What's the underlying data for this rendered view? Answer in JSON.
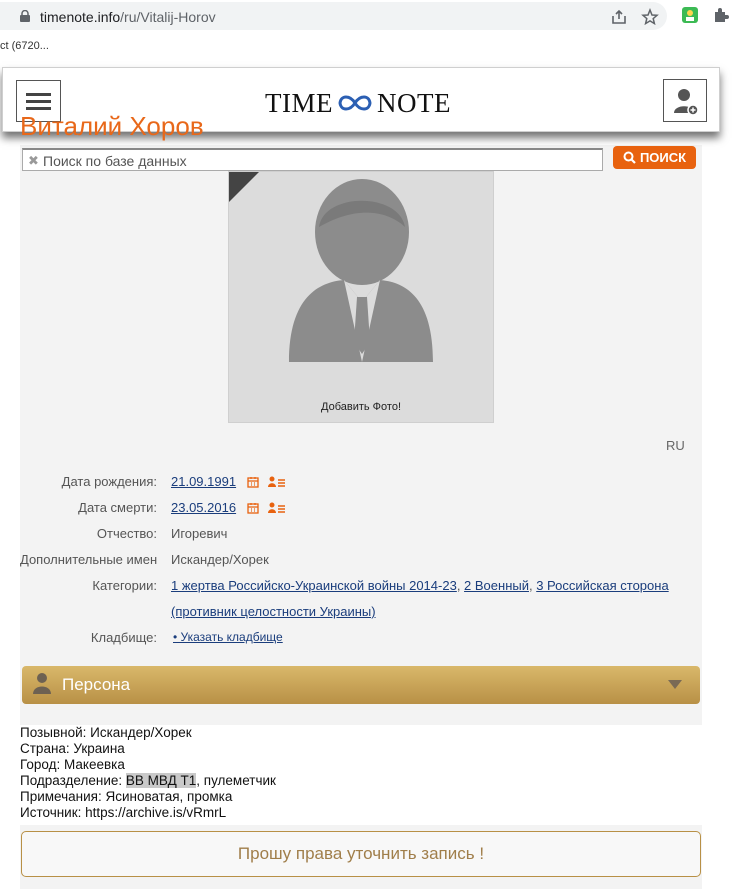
{
  "browser": {
    "url_host": "timenote.info",
    "url_path": "/ru/Vitalij-Horov",
    "bookmark": "ct (6720..."
  },
  "header": {
    "logo_left": "TIME",
    "logo_right": "NOTE"
  },
  "person": {
    "name": "Виталий Хоров"
  },
  "search": {
    "placeholder": "Поиск по базе данных",
    "button": "ПОИСК"
  },
  "photo": {
    "caption": "Добавить Фото!"
  },
  "lang": "RU",
  "fields": {
    "birth": {
      "label": "Дата рождения:",
      "value": "21.09.1991"
    },
    "death": {
      "label": "Дата смерти:",
      "value": "23.05.2016"
    },
    "patronymic": {
      "label": "Отчество:",
      "value": "Игоревич"
    },
    "extra_names": {
      "label": "Дополнительные имен",
      "value": "Искандер/Хорек"
    },
    "categories": {
      "label": "Категории:",
      "items": [
        "1 жертва Российско-Украинской войны 2014-23",
        "2 Военный",
        "3 Российская сторона",
        "(противник целостности Украины)"
      ]
    },
    "cemetery": {
      "label": "Кладбище:",
      "value": "• Указать кладбище"
    }
  },
  "persona": {
    "title": "Персона"
  },
  "description": {
    "line1": "Позывной: Искандер/Хорек",
    "line2": "Страна: Украина",
    "line3": "Город: Макеевка",
    "line4_prefix": "Подразделение: ",
    "line4_highlight": "ВВ МВД Т1",
    "line4_suffix": ", пулеметчик",
    "line5": "Примечания: Ясиноватая, промка",
    "line6": "Источник: https://archive.is/vRmrL"
  },
  "request_button": "Прошу права уточнить запись !",
  "colors": {
    "accent_orange": "#e8620f",
    "gold": "#c9a457",
    "link": "#1a3d7c"
  }
}
